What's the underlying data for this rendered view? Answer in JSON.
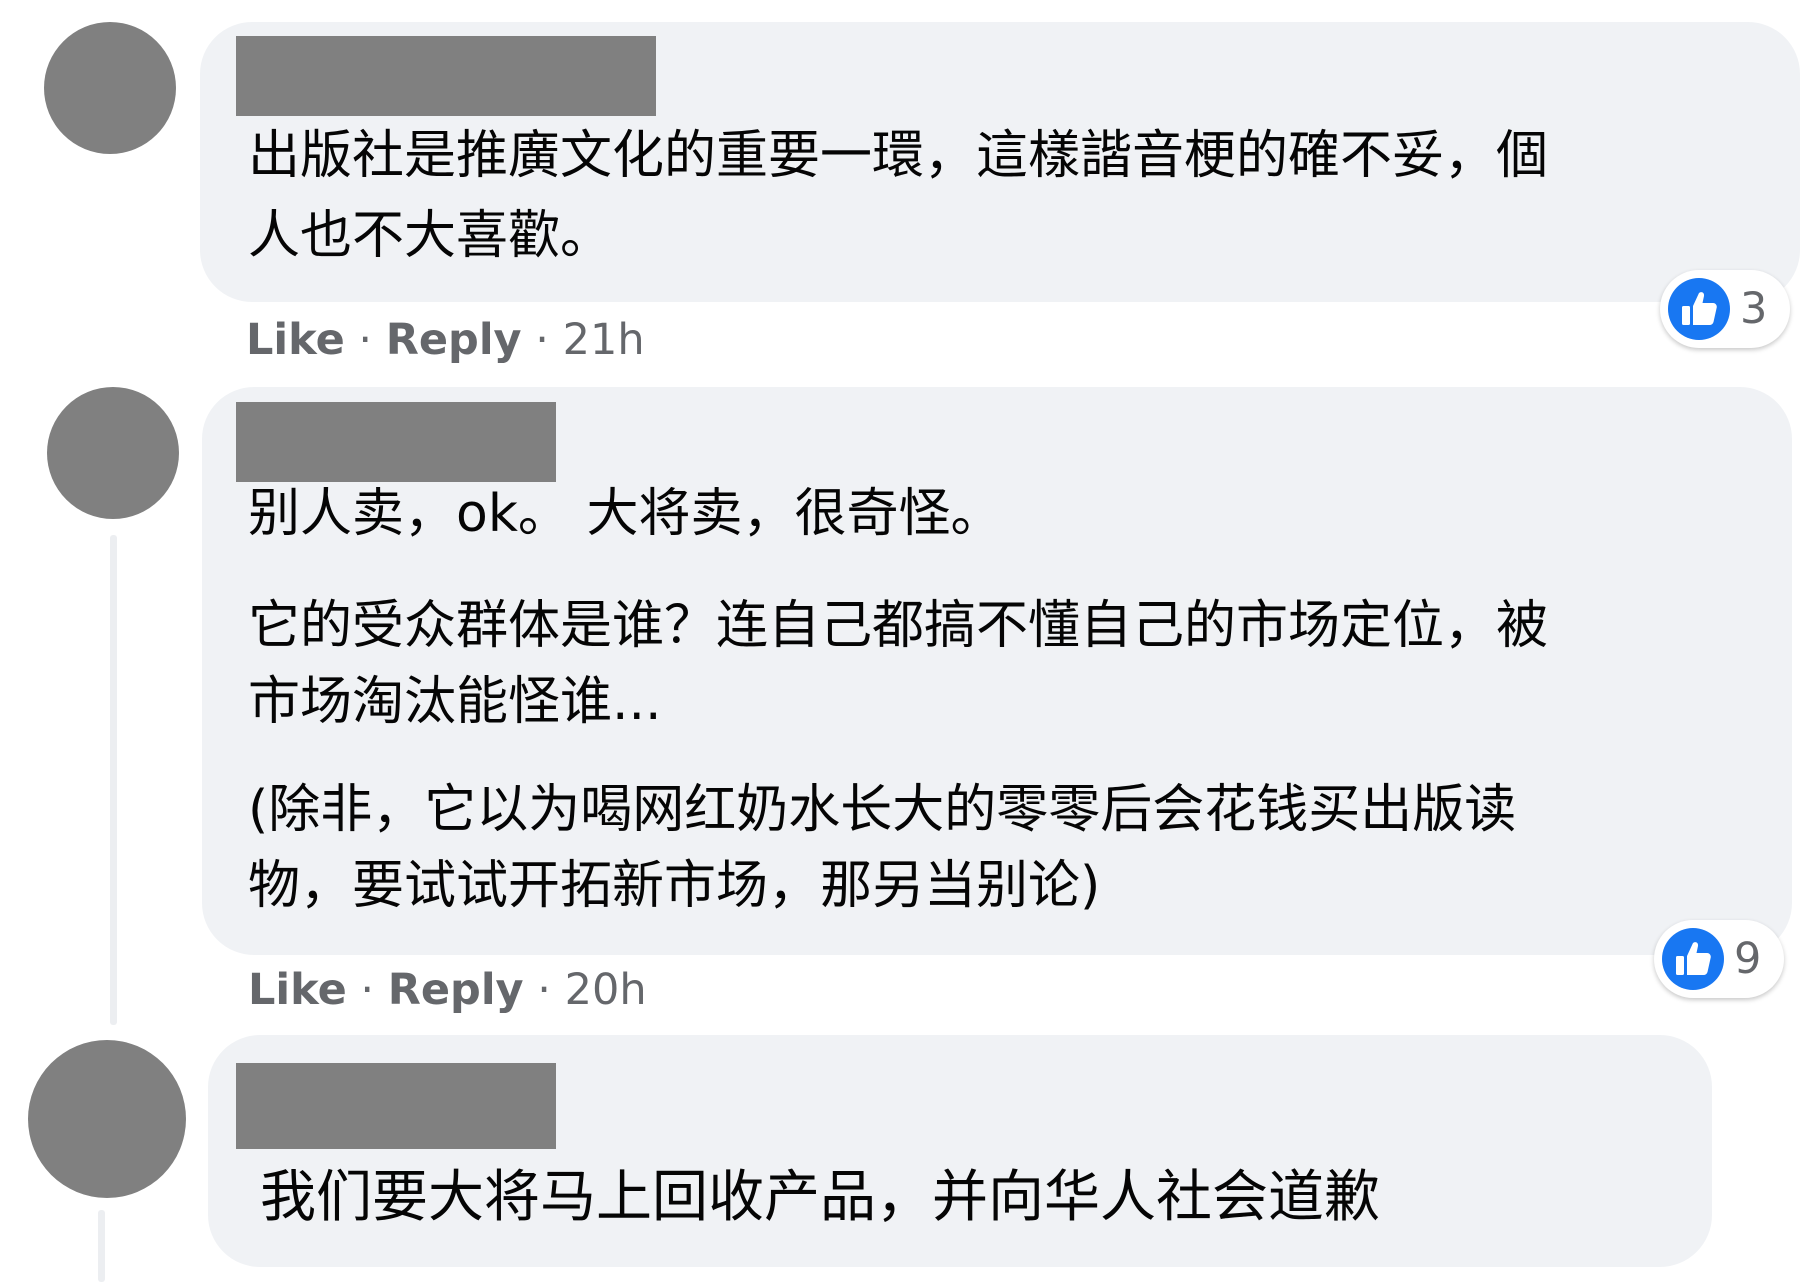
{
  "comments": [
    {
      "author": "",
      "lines": [
        "出版社是推廣文化的重要一環，這樣諧音梗的確不妥，個",
        "人也不大喜歡。"
      ],
      "actions": {
        "like": "Like",
        "sep": " · ",
        "reply": "Reply",
        "time": "21h"
      },
      "reaction": {
        "icon": "thumbs-up-icon",
        "count": "3"
      }
    },
    {
      "author": "",
      "lines": [
        "别人卖，ok。 大将卖，很奇怪。",
        "它的受众群体是谁？连自己都搞不懂自己的市场定位，被",
        "市场淘汰能怪谁...",
        "(除非，它以为喝网红奶水长大的零零后会花钱买出版读",
        "物，要试试开拓新市场，那另当别论)"
      ],
      "actions": {
        "like": "Like",
        "sep": " · ",
        "reply": "Reply",
        "time": "20h"
      },
      "reaction": {
        "icon": "thumbs-up-icon",
        "count": "9"
      }
    },
    {
      "author": "",
      "lines": [
        "我们要大将马上回收产品，并向华人社会道歉"
      ]
    }
  ],
  "colors": {
    "bubble": "#f0f2f5",
    "text": "#050505",
    "meta": "#65676b",
    "like_blue": "#1877f2",
    "redaction": "#808080"
  }
}
